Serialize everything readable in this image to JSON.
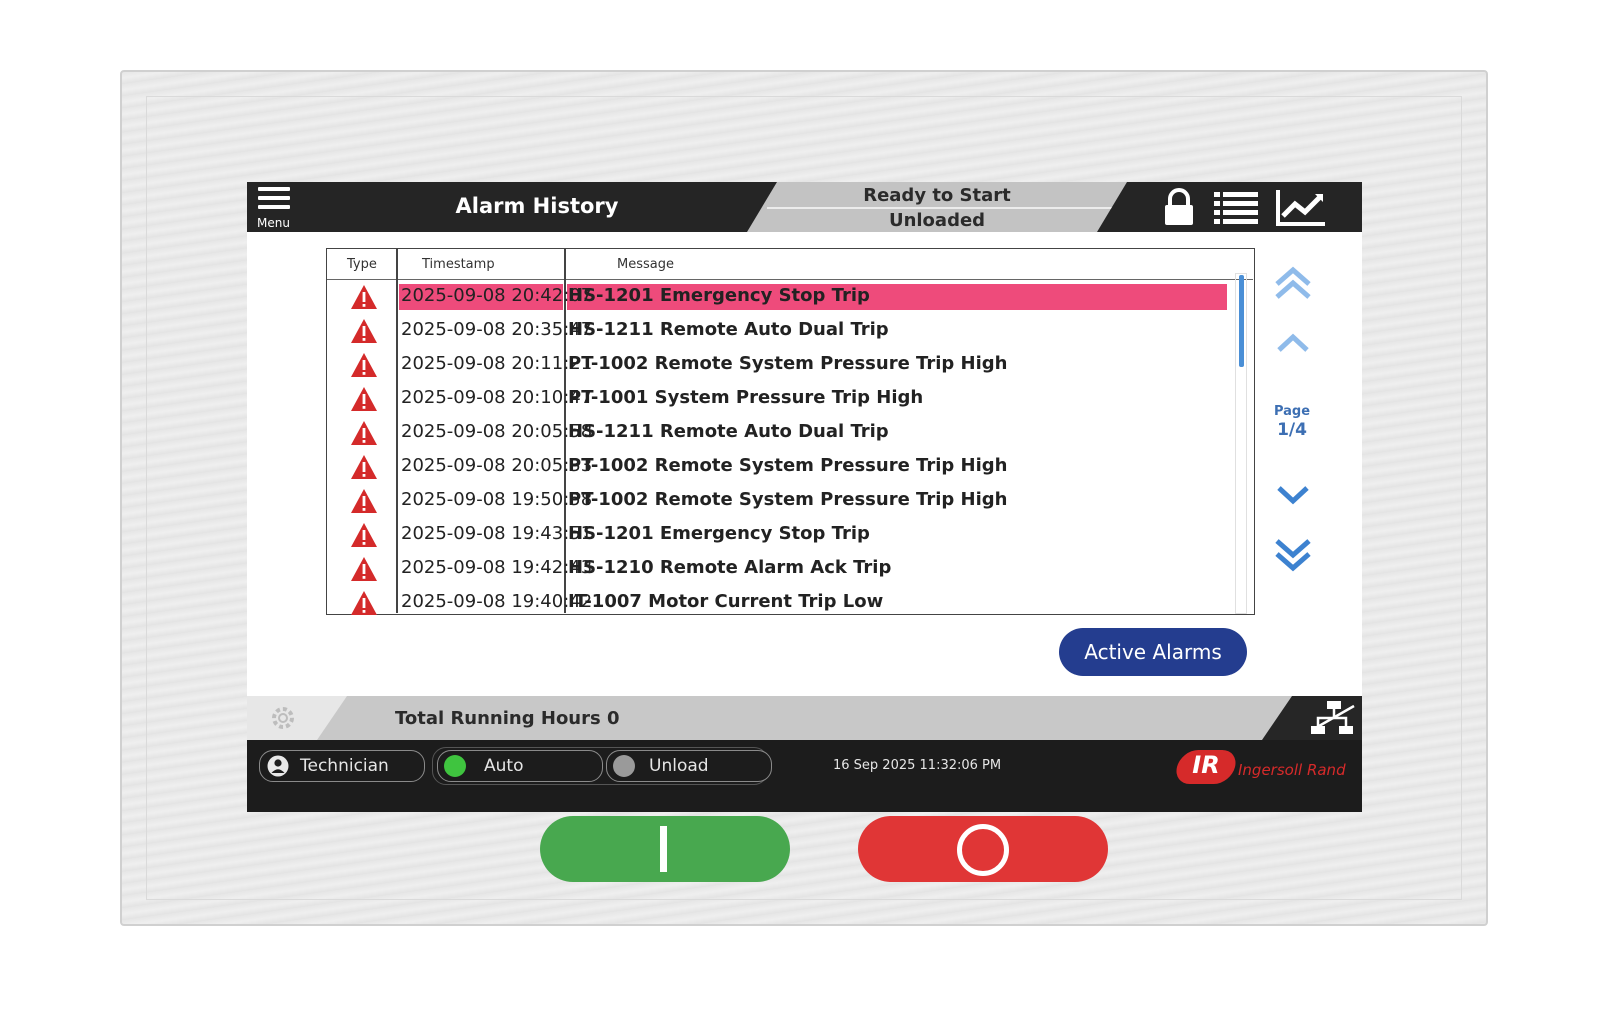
{
  "header": {
    "menu_label": "Menu",
    "title": "Alarm History",
    "status_line1": "Ready to Start",
    "status_line2": "Unloaded"
  },
  "table": {
    "columns": [
      "Type",
      "Timestamp",
      "Message"
    ],
    "rows": [
      {
        "type": "alarm-triangle-icon",
        "timestamp": "2025-09-08 20:42:07",
        "message": "HS-1201 Emergency Stop Trip",
        "selected": true
      },
      {
        "type": "alarm-triangle-icon",
        "timestamp": "2025-09-08 20:35:47",
        "message": "HS-1211 Remote Auto Dual Trip"
      },
      {
        "type": "alarm-triangle-icon",
        "timestamp": "2025-09-08 20:11:21",
        "message": "PT-1002 Remote System Pressure Trip High"
      },
      {
        "type": "alarm-triangle-icon",
        "timestamp": "2025-09-08 20:10:47",
        "message": "PT-1001 System Pressure Trip High"
      },
      {
        "type": "alarm-triangle-icon",
        "timestamp": "2025-09-08 20:05:58",
        "message": "HS-1211 Remote Auto Dual Trip"
      },
      {
        "type": "alarm-triangle-icon",
        "timestamp": "2025-09-08 20:05:33",
        "message": "PT-1002 Remote System Pressure Trip High"
      },
      {
        "type": "alarm-triangle-icon",
        "timestamp": "2025-09-08 19:50:58",
        "message": "PT-1002 Remote System Pressure Trip High"
      },
      {
        "type": "alarm-triangle-icon",
        "timestamp": "2025-09-08 19:43:51",
        "message": "HS-1201 Emergency Stop Trip"
      },
      {
        "type": "alarm-triangle-icon",
        "timestamp": "2025-09-08 19:42:43",
        "message": "HS-1210 Remote Alarm Ack Trip"
      },
      {
        "type": "alarm-triangle-icon",
        "timestamp": "2025-09-08 19:40:42",
        "message": "IT-1007 Motor Current Trip Low"
      }
    ]
  },
  "pagination": {
    "label": "Page",
    "value": "1/4",
    "current": 1,
    "total": 4
  },
  "active_alarms_button": "Active Alarms",
  "running_hours": "Total Running Hours 0",
  "footer": {
    "user": "Technician",
    "mode": "Auto",
    "load_state": "Unload",
    "datetime": "16 Sep 2025  11:32:06 PM",
    "brand_logo": "IR",
    "brand_name": "Ingersoll Rand"
  },
  "colors": {
    "header_bg": "#252525",
    "selected_row": "#ee4b7b",
    "alarm_red": "#d42a2a",
    "accent_blue": "#3d82d0",
    "active_btn": "#243d8f",
    "start_green": "#48a84f",
    "stop_red": "#e03636",
    "auto_led": "#3fc43f",
    "brand_red": "#d62a2a"
  },
  "icons": {
    "menu": "hamburger-menu-icon",
    "lock": "lock-icon",
    "list": "list-icon",
    "trend": "trend-chart-icon",
    "settings": "gear-icon",
    "network": "network-icon",
    "user": "user-icon",
    "start": "start-bar-icon",
    "stop": "stop-circle-icon"
  }
}
